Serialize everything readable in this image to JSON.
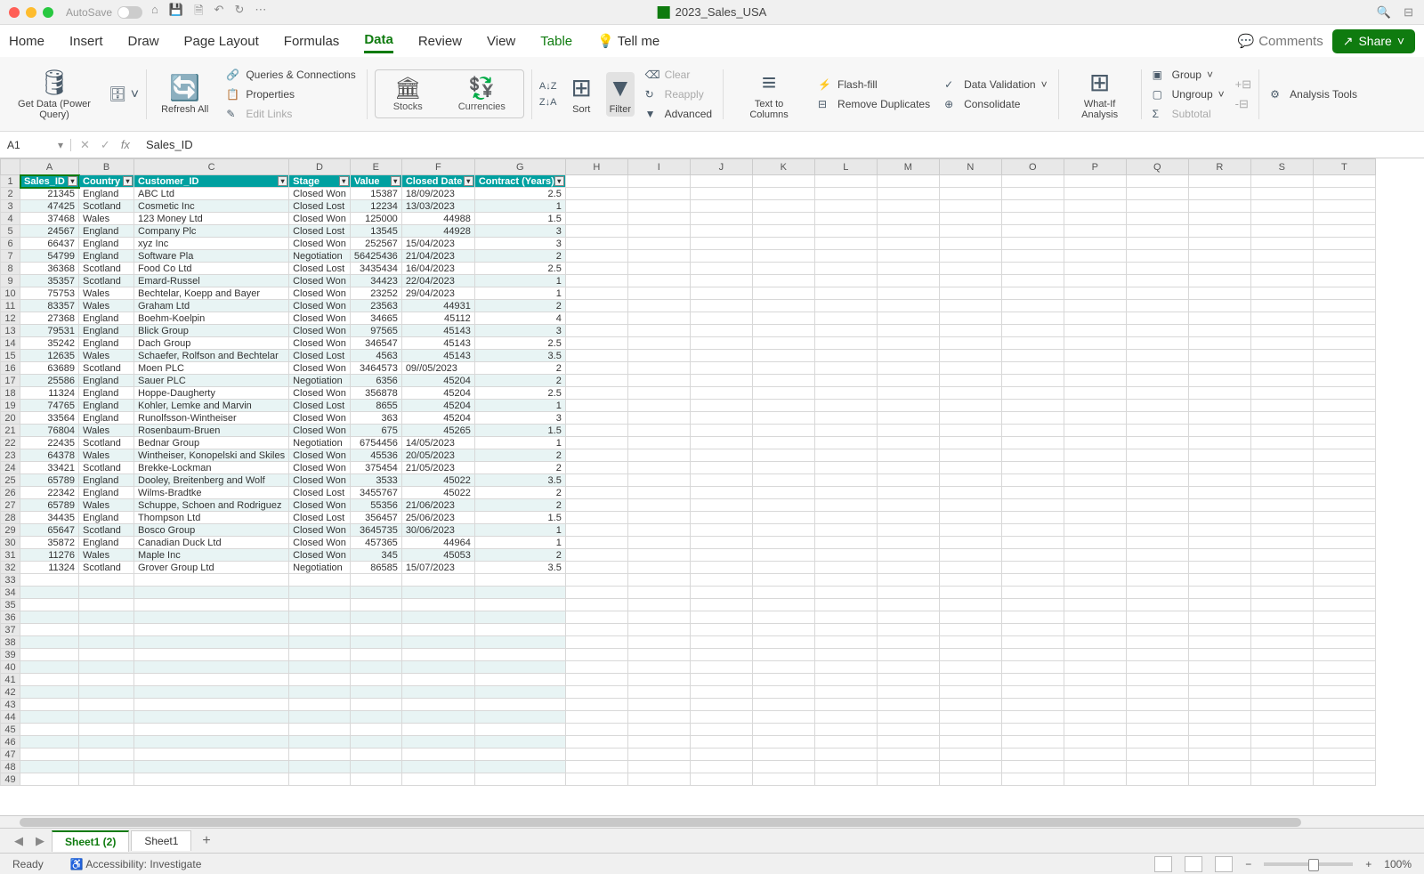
{
  "titlebar": {
    "autosave_label": "AutoSave",
    "doc_title": "2023_Sales_USA"
  },
  "tabs": {
    "home": "Home",
    "insert": "Insert",
    "draw": "Draw",
    "page_layout": "Page Layout",
    "formulas": "Formulas",
    "data": "Data",
    "review": "Review",
    "view": "View",
    "table": "Table",
    "tell_me": "Tell me",
    "comments": "Comments",
    "share": "Share"
  },
  "ribbon": {
    "get_data": "Get Data (Power Query)",
    "refresh_all": "Refresh All",
    "queries": "Queries & Connections",
    "properties": "Properties",
    "edit_links": "Edit Links",
    "stocks": "Stocks",
    "currencies": "Currencies",
    "sort": "Sort",
    "filter": "Filter",
    "clear": "Clear",
    "reapply": "Reapply",
    "advanced": "Advanced",
    "text_to_cols": "Text to Columns",
    "flash_fill": "Flash-fill",
    "remove_dups": "Remove Duplicates",
    "data_val": "Data Validation",
    "consolidate": "Consolidate",
    "whatif": "What-If Analysis",
    "group": "Group",
    "ungroup": "Ungroup",
    "subtotal": "Subtotal",
    "analysis_tools": "Analysis Tools"
  },
  "fbar": {
    "cell": "A1",
    "formula": "Sales_ID"
  },
  "columns": [
    "A",
    "B",
    "C",
    "D",
    "E",
    "F",
    "G",
    "H",
    "I",
    "J",
    "K",
    "L",
    "M",
    "N",
    "O",
    "P",
    "Q",
    "R",
    "S",
    "T"
  ],
  "headers": [
    "Sales_ID",
    "Country",
    "Customer_ID",
    "Stage",
    "Value",
    "Closed Date",
    "Contract (Years)"
  ],
  "rows": [
    [
      "21345",
      "England",
      "ABC Ltd",
      "Closed Won",
      "15387",
      "18/09/2023",
      "2.5"
    ],
    [
      "47425",
      "Scotland",
      "Cosmetic Inc",
      "Closed Lost",
      "12234",
      "13/03/2023",
      "1"
    ],
    [
      "37468",
      "Wales",
      "123 Money Ltd",
      "Closed Won",
      "125000",
      "44988",
      "1.5"
    ],
    [
      "24567",
      "England",
      "Company Plc",
      "Closed Lost",
      "13545",
      "44928",
      "3"
    ],
    [
      "66437",
      "England",
      "xyz Inc",
      "Closed Won",
      "252567",
      "15/04/2023",
      "3"
    ],
    [
      "54799",
      "England",
      "Software Pla",
      "Negotiation",
      "56425436",
      "21/04/2023",
      "2"
    ],
    [
      "36368",
      "Scotland",
      "Food Co Ltd",
      "Closed Lost",
      "3435434",
      "16/04/2023",
      "2.5"
    ],
    [
      "35357",
      "Scotland",
      "Emard-Russel",
      "Closed Won",
      "34423",
      "22/04/2023",
      "1"
    ],
    [
      "75753",
      "Wales",
      "Bechtelar, Koepp and Bayer",
      "Closed Won",
      "23252",
      "29/04/2023",
      "1"
    ],
    [
      "83357",
      "Wales",
      "Graham Ltd",
      "Closed Won",
      "23563",
      "44931",
      "2"
    ],
    [
      "27368",
      "England",
      "Boehm-Koelpin",
      "Closed Won",
      "34665",
      "45112",
      "4"
    ],
    [
      "79531",
      "England",
      "Blick Group",
      "Closed Won",
      "97565",
      "45143",
      "3"
    ],
    [
      "35242",
      "England",
      "Dach Group",
      "Closed Won",
      "346547",
      "45143",
      "2.5"
    ],
    [
      "12635",
      "Wales",
      "Schaefer, Rolfson and Bechtelar",
      "Closed Lost",
      "4563",
      "45143",
      "3.5"
    ],
    [
      "63689",
      "Scotland",
      "Moen PLC",
      "Closed Won",
      "3464573",
      "09//05/2023",
      "2"
    ],
    [
      "25586",
      "England",
      "Sauer PLC",
      "Negotiation",
      "6356",
      "45204",
      "2"
    ],
    [
      "11324",
      "England",
      "Hoppe-Daugherty",
      "Closed Won",
      "356878",
      "45204",
      "2.5"
    ],
    [
      "74765",
      "England",
      "Kohler, Lemke and Marvin",
      "Closed Lost",
      "8655",
      "45204",
      "1"
    ],
    [
      "33564",
      "England",
      "Runolfsson-Wintheiser",
      "Closed Won",
      "363",
      "45204",
      "3"
    ],
    [
      "76804",
      "Wales",
      "Rosenbaum-Bruen",
      "Closed Won",
      "675",
      "45265",
      "1.5"
    ],
    [
      "22435",
      "Scotland",
      "Bednar Group",
      "Negotiation",
      "6754456",
      "14/05/2023",
      "1"
    ],
    [
      "64378",
      "Wales",
      "Wintheiser, Konopelski and Skiles",
      "Closed Won",
      "45536",
      "20/05/2023",
      "2"
    ],
    [
      "33421",
      "Scotland",
      "Brekke-Lockman",
      "Closed Won",
      "375454",
      "21/05/2023",
      "2"
    ],
    [
      "65789",
      "England",
      "Dooley, Breitenberg and Wolf",
      "Closed Won",
      "3533",
      "45022",
      "3.5"
    ],
    [
      "22342",
      "England",
      "Wilms-Bradtke",
      "Closed Lost",
      "3455767",
      "45022",
      "2"
    ],
    [
      "65789",
      "Wales",
      "Schuppe, Schoen and Rodriguez",
      "Closed Won",
      "55356",
      "21/06/2023",
      "2"
    ],
    [
      "34435",
      "England",
      "Thompson Ltd",
      "Closed Lost",
      "356457",
      "25/06/2023",
      "1.5"
    ],
    [
      "65647",
      "Scotland",
      "Bosco Group",
      "Closed Won",
      "3645735",
      "30/06/2023",
      "1"
    ],
    [
      "35872",
      "England",
      "Canadian Duck Ltd",
      "Closed Won",
      "457365",
      "44964",
      "1"
    ],
    [
      "11276",
      "Wales",
      "Maple Inc",
      "Closed Won",
      "345",
      "45053",
      "2"
    ],
    [
      "11324",
      "Scotland",
      "Grover Group Ltd",
      "Negotiation",
      "86585",
      "15/07/2023",
      "3.5"
    ]
  ],
  "sheets": {
    "s1": "Sheet1 (2)",
    "s2": "Sheet1"
  },
  "status": {
    "ready": "Ready",
    "access": "Accessibility: Investigate",
    "zoom": "100%"
  }
}
